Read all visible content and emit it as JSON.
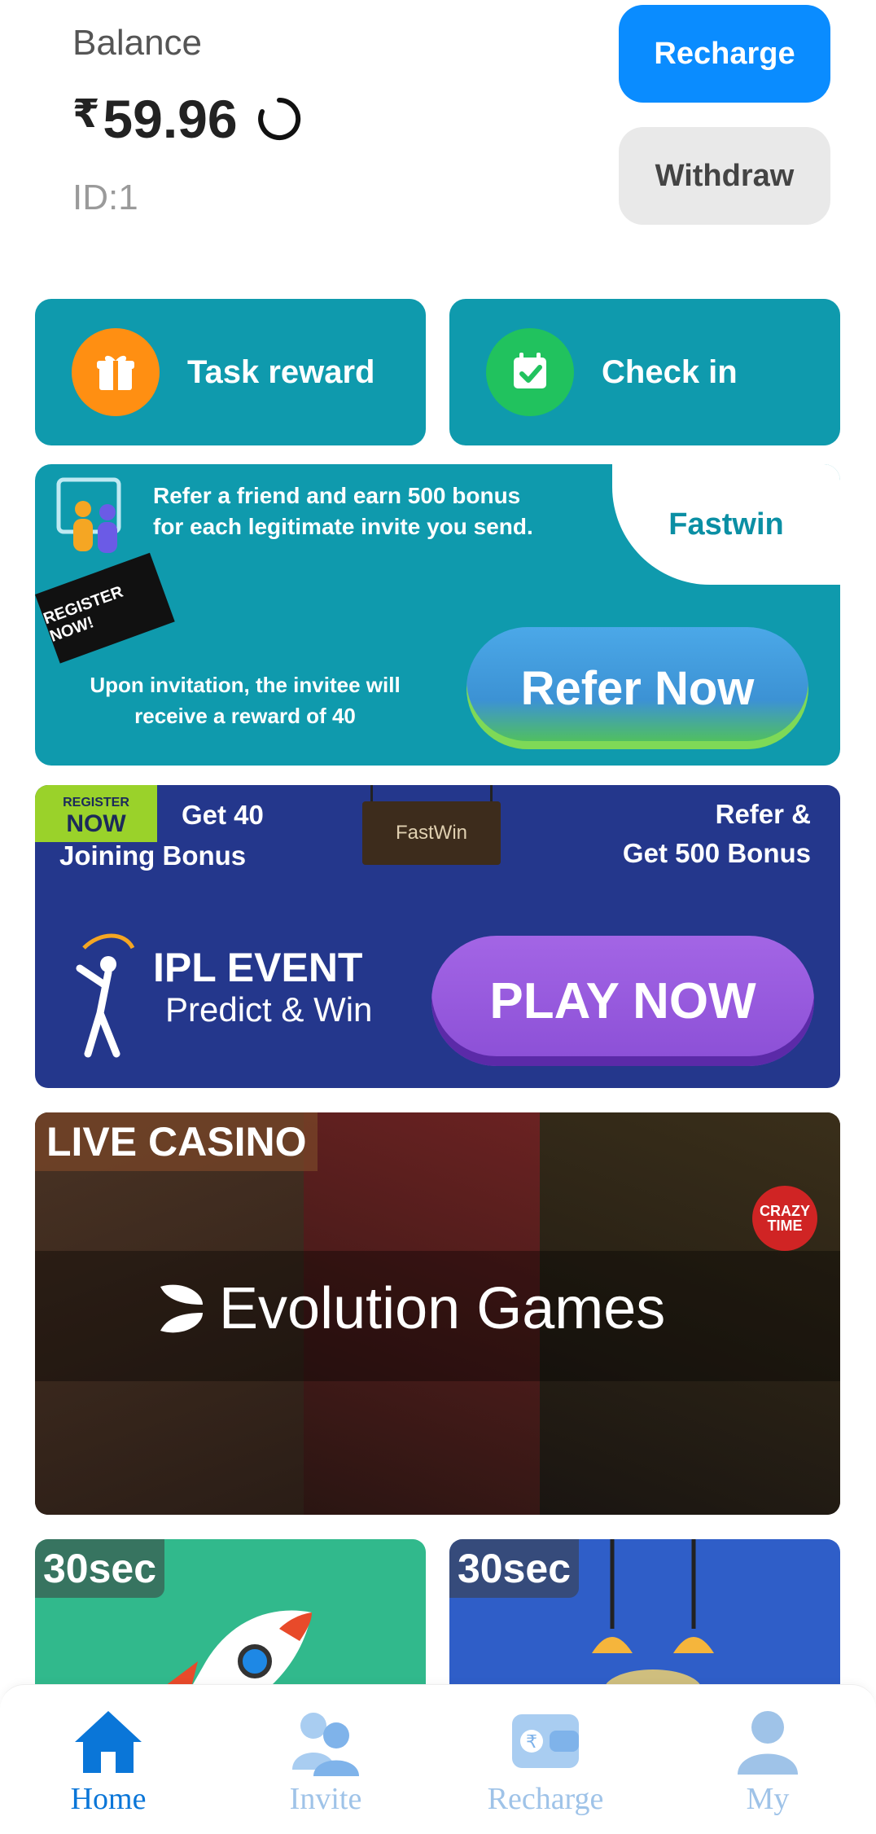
{
  "header": {
    "balance_label": "Balance",
    "currency_symbol": "₹",
    "balance_value": "59.96",
    "user_id": "ID:1",
    "recharge_label": "Recharge",
    "withdraw_label": "Withdraw"
  },
  "quick_actions": [
    {
      "label": "Task reward",
      "icon": "gift-icon"
    },
    {
      "label": "Check in",
      "icon": "calendar-check-icon"
    }
  ],
  "refer_banner": {
    "line1": "Refer a friend and earn 500 bonus",
    "line2": "for each legitimate invite you send.",
    "brand": "Fastwin",
    "register_tag": "REGISTER NOW!",
    "invitee_line1": "Upon invitation, the invitee will",
    "invitee_line2": "receive a reward of 40",
    "cta": "Refer Now"
  },
  "ipl_banner": {
    "register_small": "REGISTER",
    "register_big": "NOW",
    "joining_line1": "Get 40",
    "joining_line2": "Joining Bonus",
    "sign": "FastWin",
    "refer_line1": "Refer &",
    "refer_line2": "Get 500 Bonus",
    "title": "IPL EVENT",
    "subtitle": "Predict & Win",
    "cta": "PLAY NOW"
  },
  "casino_banner": {
    "tag": "LIVE CASINO",
    "brand": "Evolution Games",
    "badge": "CRAZY TIME"
  },
  "games": [
    {
      "badge": "30sec",
      "color": "#31b98c"
    },
    {
      "badge": "30sec",
      "color": "#2f5ec8"
    }
  ],
  "bottom_nav": [
    {
      "label": "Home",
      "icon": "home-icon",
      "active": true
    },
    {
      "label": "Invite",
      "icon": "invite-icon",
      "active": false
    },
    {
      "label": "Recharge",
      "icon": "wallet-icon",
      "active": false
    },
    {
      "label": "My",
      "icon": "user-icon",
      "active": false
    }
  ],
  "colors": {
    "accent": "#0a8cff",
    "teal": "#0f9aad",
    "navy": "#24378c",
    "purple": "#8b4fd6"
  }
}
